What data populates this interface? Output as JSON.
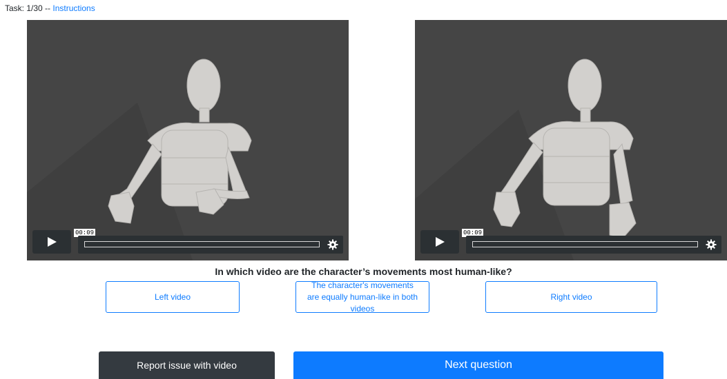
{
  "task": {
    "prefix": "Task: 1/30 -- ",
    "instructions_link": "Instructions"
  },
  "videos": [
    {
      "id": "left",
      "time": "00:09",
      "play_icon": "play-icon",
      "settings_icon": "gear-icon"
    },
    {
      "id": "right",
      "time": "00:09",
      "play_icon": "play-icon",
      "settings_icon": "gear-icon"
    }
  ],
  "question": "In which video are the character’s movements most human-like?",
  "choices": {
    "left": "Left video",
    "equal": "The character's movements are equally human-like in both videos",
    "right": "Right video"
  },
  "buttons": {
    "report": "Report issue with video",
    "next": "Next question"
  },
  "colors": {
    "accent": "#0d7bff",
    "dark_button": "#343a40",
    "video_background": "#434343"
  }
}
